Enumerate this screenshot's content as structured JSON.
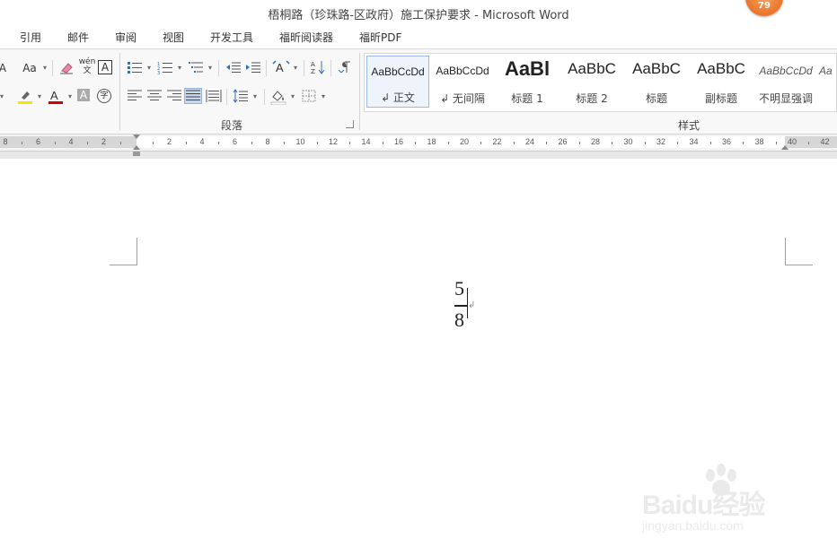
{
  "window": {
    "title": "梧桐路（珍珠路-区政府）施工保护要求 - Microsoft Word",
    "badge_count": "79"
  },
  "tabs": [
    {
      "label": "引用"
    },
    {
      "label": "邮件"
    },
    {
      "label": "审阅"
    },
    {
      "label": "视图"
    },
    {
      "label": "开发工具"
    },
    {
      "label": "福昕阅读器"
    },
    {
      "label": "福昕PDF"
    }
  ],
  "ribbon": {
    "paragraph_group_label": "段落",
    "styles_group_label": "样式",
    "font_change_case": "Aa",
    "phonetic_guide": "wén",
    "styles": [
      {
        "sample": "AaBbCcDd",
        "name": "↲ 正文",
        "selected": true
      },
      {
        "sample": "AaBbCcDd",
        "name": "↲ 无间隔",
        "selected": false
      },
      {
        "sample": "AaBl",
        "name": "标题 1",
        "selected": false
      },
      {
        "sample": "AaBbC",
        "name": "标题 2",
        "selected": false
      },
      {
        "sample": "AaBbC",
        "name": "标题",
        "selected": false
      },
      {
        "sample": "AaBbC",
        "name": "副标题",
        "selected": false
      },
      {
        "sample": "AaBbCcDd",
        "name": "不明显强调",
        "selected": false
      },
      {
        "sample": "Aa",
        "name": "",
        "selected": false
      }
    ]
  },
  "ruler": {
    "left_labels": [
      "8",
      "6",
      "4",
      "2"
    ],
    "labels": [
      "2",
      "4",
      "6",
      "8",
      "10",
      "12",
      "14",
      "16",
      "18",
      "20",
      "22",
      "24",
      "26",
      "28",
      "30",
      "32",
      "34",
      "36",
      "38",
      "40",
      "42"
    ]
  },
  "document": {
    "numerator": "5",
    "denominator": "8"
  },
  "watermark": {
    "brand": "Baidu经验",
    "url": "jingyan.baidu.com"
  },
  "colors": {
    "highlight": "#f3e600",
    "font_color": "#d40000",
    "badge": "#e9742a"
  }
}
